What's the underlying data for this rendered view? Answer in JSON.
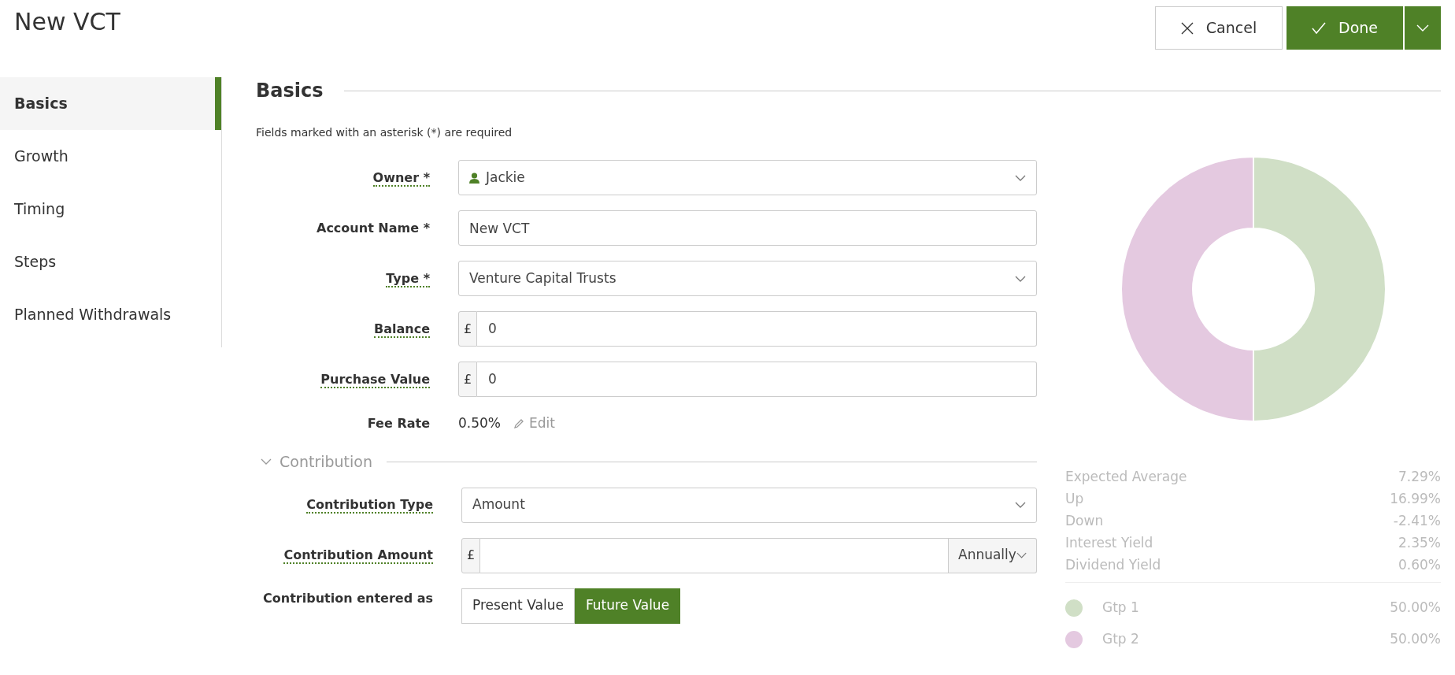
{
  "page_title": "New VCT",
  "actions": {
    "cancel": "Cancel",
    "done": "Done"
  },
  "sidebar": {
    "items": [
      {
        "label": "Basics",
        "selected": true
      },
      {
        "label": "Growth",
        "selected": false
      },
      {
        "label": "Timing",
        "selected": false
      },
      {
        "label": "Steps",
        "selected": false
      },
      {
        "label": "Planned Withdrawals",
        "selected": false
      }
    ]
  },
  "section": {
    "title": "Basics",
    "note": "Fields marked with an asterisk (*) are required",
    "fields": [
      {
        "kind": "person_select",
        "label": "Owner *",
        "help": true,
        "value": "Jackie"
      },
      {
        "kind": "text",
        "label": "Account Name *",
        "help": false,
        "value": "New VCT"
      },
      {
        "kind": "select",
        "label": "Type *",
        "help": true,
        "value": "Venture Capital Trusts"
      },
      {
        "kind": "currency",
        "label": "Balance",
        "help": true,
        "currency": "£",
        "value": "0"
      },
      {
        "kind": "currency",
        "label": "Purchase Value",
        "help": true,
        "currency": "£",
        "value": "0"
      },
      {
        "kind": "static",
        "label": "Fee Rate",
        "help": false,
        "value": "0.50%",
        "action": "Edit"
      }
    ]
  },
  "contribution": {
    "title": "Contribution",
    "expanded": true,
    "fields": [
      {
        "kind": "select",
        "label": "Contribution Type",
        "help": true,
        "value": "Amount"
      },
      {
        "kind": "currency_select",
        "label": "Contribution Amount",
        "help": true,
        "currency": "£",
        "period": "Annually"
      },
      {
        "kind": "toggle",
        "label": "Contribution entered as",
        "help": false,
        "options": [
          {
            "label": "Present Value",
            "selected": false
          },
          {
            "label": "Future Value",
            "selected": true
          }
        ]
      }
    ]
  },
  "allocation": {
    "chart_data": {
      "type": "donut",
      "categories": [
        "Gtp 1",
        "Gtp 2"
      ],
      "values": [
        50,
        50
      ]
    },
    "stats": [
      {
        "label": "Expected Average",
        "value": "7.29%"
      },
      {
        "label": "Up",
        "value": "16.99%"
      },
      {
        "label": "Down",
        "value": "-2.41%"
      },
      {
        "label": "Interest Yield",
        "value": "2.35%"
      },
      {
        "label": "Dividend Yield",
        "value": "0.60%"
      }
    ],
    "legend": [
      {
        "color": "#d0dfc6",
        "value": "50.00%"
      },
      {
        "color": "#e4c9e0",
        "value": "50.00%"
      }
    ]
  }
}
